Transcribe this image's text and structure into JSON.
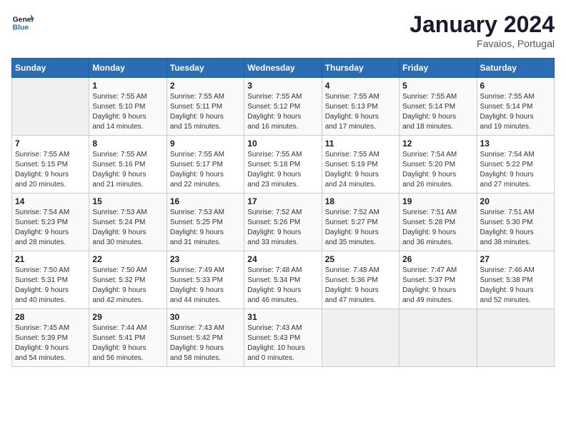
{
  "header": {
    "logo_line1": "General",
    "logo_line2": "Blue",
    "title": "January 2024",
    "subtitle": "Favaios, Portugal"
  },
  "days_of_week": [
    "Sunday",
    "Monday",
    "Tuesday",
    "Wednesday",
    "Thursday",
    "Friday",
    "Saturday"
  ],
  "weeks": [
    [
      {
        "day": "",
        "info": ""
      },
      {
        "day": "1",
        "info": "Sunrise: 7:55 AM\nSunset: 5:10 PM\nDaylight: 9 hours\nand 14 minutes."
      },
      {
        "day": "2",
        "info": "Sunrise: 7:55 AM\nSunset: 5:11 PM\nDaylight: 9 hours\nand 15 minutes."
      },
      {
        "day": "3",
        "info": "Sunrise: 7:55 AM\nSunset: 5:12 PM\nDaylight: 9 hours\nand 16 minutes."
      },
      {
        "day": "4",
        "info": "Sunrise: 7:55 AM\nSunset: 5:13 PM\nDaylight: 9 hours\nand 17 minutes."
      },
      {
        "day": "5",
        "info": "Sunrise: 7:55 AM\nSunset: 5:14 PM\nDaylight: 9 hours\nand 18 minutes."
      },
      {
        "day": "6",
        "info": "Sunrise: 7:55 AM\nSunset: 5:14 PM\nDaylight: 9 hours\nand 19 minutes."
      }
    ],
    [
      {
        "day": "7",
        "info": "Sunrise: 7:55 AM\nSunset: 5:15 PM\nDaylight: 9 hours\nand 20 minutes."
      },
      {
        "day": "8",
        "info": "Sunrise: 7:55 AM\nSunset: 5:16 PM\nDaylight: 9 hours\nand 21 minutes."
      },
      {
        "day": "9",
        "info": "Sunrise: 7:55 AM\nSunset: 5:17 PM\nDaylight: 9 hours\nand 22 minutes."
      },
      {
        "day": "10",
        "info": "Sunrise: 7:55 AM\nSunset: 5:18 PM\nDaylight: 9 hours\nand 23 minutes."
      },
      {
        "day": "11",
        "info": "Sunrise: 7:55 AM\nSunset: 5:19 PM\nDaylight: 9 hours\nand 24 minutes."
      },
      {
        "day": "12",
        "info": "Sunrise: 7:54 AM\nSunset: 5:20 PM\nDaylight: 9 hours\nand 26 minutes."
      },
      {
        "day": "13",
        "info": "Sunrise: 7:54 AM\nSunset: 5:22 PM\nDaylight: 9 hours\nand 27 minutes."
      }
    ],
    [
      {
        "day": "14",
        "info": "Sunrise: 7:54 AM\nSunset: 5:23 PM\nDaylight: 9 hours\nand 28 minutes."
      },
      {
        "day": "15",
        "info": "Sunrise: 7:53 AM\nSunset: 5:24 PM\nDaylight: 9 hours\nand 30 minutes."
      },
      {
        "day": "16",
        "info": "Sunrise: 7:53 AM\nSunset: 5:25 PM\nDaylight: 9 hours\nand 31 minutes."
      },
      {
        "day": "17",
        "info": "Sunrise: 7:52 AM\nSunset: 5:26 PM\nDaylight: 9 hours\nand 33 minutes."
      },
      {
        "day": "18",
        "info": "Sunrise: 7:52 AM\nSunset: 5:27 PM\nDaylight: 9 hours\nand 35 minutes."
      },
      {
        "day": "19",
        "info": "Sunrise: 7:51 AM\nSunset: 5:28 PM\nDaylight: 9 hours\nand 36 minutes."
      },
      {
        "day": "20",
        "info": "Sunrise: 7:51 AM\nSunset: 5:30 PM\nDaylight: 9 hours\nand 38 minutes."
      }
    ],
    [
      {
        "day": "21",
        "info": "Sunrise: 7:50 AM\nSunset: 5:31 PM\nDaylight: 9 hours\nand 40 minutes."
      },
      {
        "day": "22",
        "info": "Sunrise: 7:50 AM\nSunset: 5:32 PM\nDaylight: 9 hours\nand 42 minutes."
      },
      {
        "day": "23",
        "info": "Sunrise: 7:49 AM\nSunset: 5:33 PM\nDaylight: 9 hours\nand 44 minutes."
      },
      {
        "day": "24",
        "info": "Sunrise: 7:48 AM\nSunset: 5:34 PM\nDaylight: 9 hours\nand 46 minutes."
      },
      {
        "day": "25",
        "info": "Sunrise: 7:48 AM\nSunset: 5:36 PM\nDaylight: 9 hours\nand 47 minutes."
      },
      {
        "day": "26",
        "info": "Sunrise: 7:47 AM\nSunset: 5:37 PM\nDaylight: 9 hours\nand 49 minutes."
      },
      {
        "day": "27",
        "info": "Sunrise: 7:46 AM\nSunset: 5:38 PM\nDaylight: 9 hours\nand 52 minutes."
      }
    ],
    [
      {
        "day": "28",
        "info": "Sunrise: 7:45 AM\nSunset: 5:39 PM\nDaylight: 9 hours\nand 54 minutes."
      },
      {
        "day": "29",
        "info": "Sunrise: 7:44 AM\nSunset: 5:41 PM\nDaylight: 9 hours\nand 56 minutes."
      },
      {
        "day": "30",
        "info": "Sunrise: 7:43 AM\nSunset: 5:42 PM\nDaylight: 9 hours\nand 58 minutes."
      },
      {
        "day": "31",
        "info": "Sunrise: 7:43 AM\nSunset: 5:43 PM\nDaylight: 10 hours\nand 0 minutes."
      },
      {
        "day": "",
        "info": ""
      },
      {
        "day": "",
        "info": ""
      },
      {
        "day": "",
        "info": ""
      }
    ]
  ]
}
